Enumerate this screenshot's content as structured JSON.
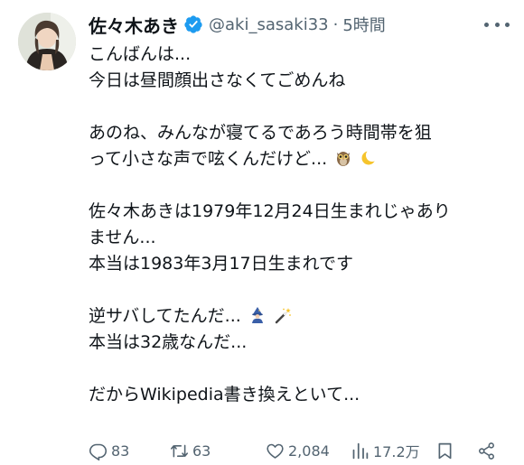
{
  "author": {
    "display_name": "佐々木あき",
    "handle": "@aki_sasaki33",
    "separator": "·",
    "timestamp": "5時間",
    "verified": true,
    "verified_color": "#1d9bf0"
  },
  "tweet": {
    "lines": [
      "こんばんは...",
      "今日は昼間顔出さなくてごめんね",
      "",
      "あのね、みんなが寝てるであろう時間帯を狙",
      "って小さな声で呟くんだけど...",
      "",
      "佐々木あきは1979年12月24日生まれじゃあり",
      "ません...",
      "本当は1983年3月17日生まれです",
      "",
      "逆サバしてたんだ...",
      "本当は32歳なんだ...",
      "",
      "だからWikipedia書き換えといて..."
    ],
    "emojis": {
      "line_4": [
        "owl-emoji",
        "crescent-moon-emoji"
      ],
      "line_10": [
        "mage-emoji",
        "magic-wand-emoji"
      ]
    }
  },
  "actions": {
    "replies": "83",
    "retweets": "63",
    "likes": "2,084",
    "views": "17.2万"
  },
  "colors": {
    "text": "#0f1419",
    "secondary": "#536471",
    "accent": "#1d9bf0"
  }
}
